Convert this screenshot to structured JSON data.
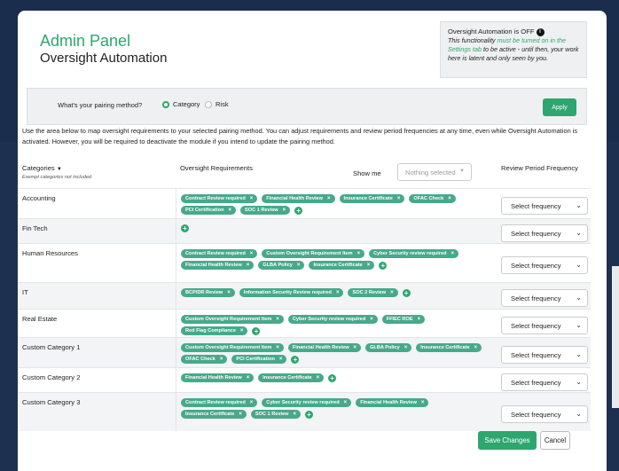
{
  "header": {
    "title": "Admin Panel",
    "subtitle": "Oversight Automation"
  },
  "notice": {
    "title": "Oversight Automation is OFF",
    "line1": "This functionality ",
    "line1_green": "must be turned on in the Settings tab",
    "line2": " to be active - until then, your work here is latent and only seen by you."
  },
  "pairing": {
    "question": "What's your pairing method?",
    "options": [
      {
        "label": "Category",
        "selected": true
      },
      {
        "label": "Risk",
        "selected": false
      }
    ],
    "apply_label": "Apply"
  },
  "description": "Use the area below to map oversight requirements to your selected pairing method. You can adjust requirements and review period frequencies at any time, even while Oversight Automation is activated. However, you will be required to deactivate the module if you intend to update the pairing method.",
  "table": {
    "col_categories": "Categories",
    "col_categories_note": "Exempt categories not included",
    "col_requirements": "Oversight Requirements",
    "show_me_label": "Show me",
    "show_me_value": "Nothing selected",
    "col_frequency": "Review Period Frequency",
    "frequency_placeholder": "Select frequency",
    "rows": [
      {
        "category": "Accounting",
        "tags": [
          "Contract Review required",
          "Financial Health Review",
          "Insurance Certificate",
          "OFAC Check",
          "PCI Certification",
          "SOC 1 Review"
        ]
      },
      {
        "category": "Fin Tech",
        "tags": []
      },
      {
        "category": "Human Resources",
        "tags": [
          "Contract Review required",
          "Custom Oversight Requirement Item",
          "Cyber Security review required",
          "Financial Health Review",
          "GLBA Policy",
          "Insurance Certificate"
        ]
      },
      {
        "category": "IT",
        "tags": [
          "BCP/DR Review",
          "Information Security Review required",
          "SOC 2 Review"
        ]
      },
      {
        "category": "Real Estate",
        "tags": [
          "Custom Oversight Requirement Item",
          "Cyber Security review required",
          "FFIEC ROE",
          "Red Flag Compliance"
        ]
      },
      {
        "category": "Custom Category 1",
        "tags": [
          "Custom Oversight Requirement Item",
          "Financial Health Review",
          "GLBA Policy",
          "Insurance Certificate",
          "OFAC Check",
          "PCI Certification"
        ]
      },
      {
        "category": "Custom Category 2",
        "tags": [
          "Financial Health Review",
          "Insurance Certificate"
        ]
      },
      {
        "category": "Custom Category 3",
        "tags": [
          "Contract Review required",
          "Cyber Security review required",
          "Financial Health Review",
          "Insurance Certificate",
          "SOC 1 Review"
        ]
      }
    ]
  },
  "footer": {
    "save_label": "Save Changes",
    "cancel_label": "Cancel"
  },
  "colors": {
    "accent": "#2ea66f",
    "tag": "#47a98a",
    "background": "#1e3050"
  },
  "icons": {
    "info": "info-icon",
    "plus": "plus-circle-icon",
    "remove": "close-icon",
    "dropdown": "chevron-down-icon"
  }
}
